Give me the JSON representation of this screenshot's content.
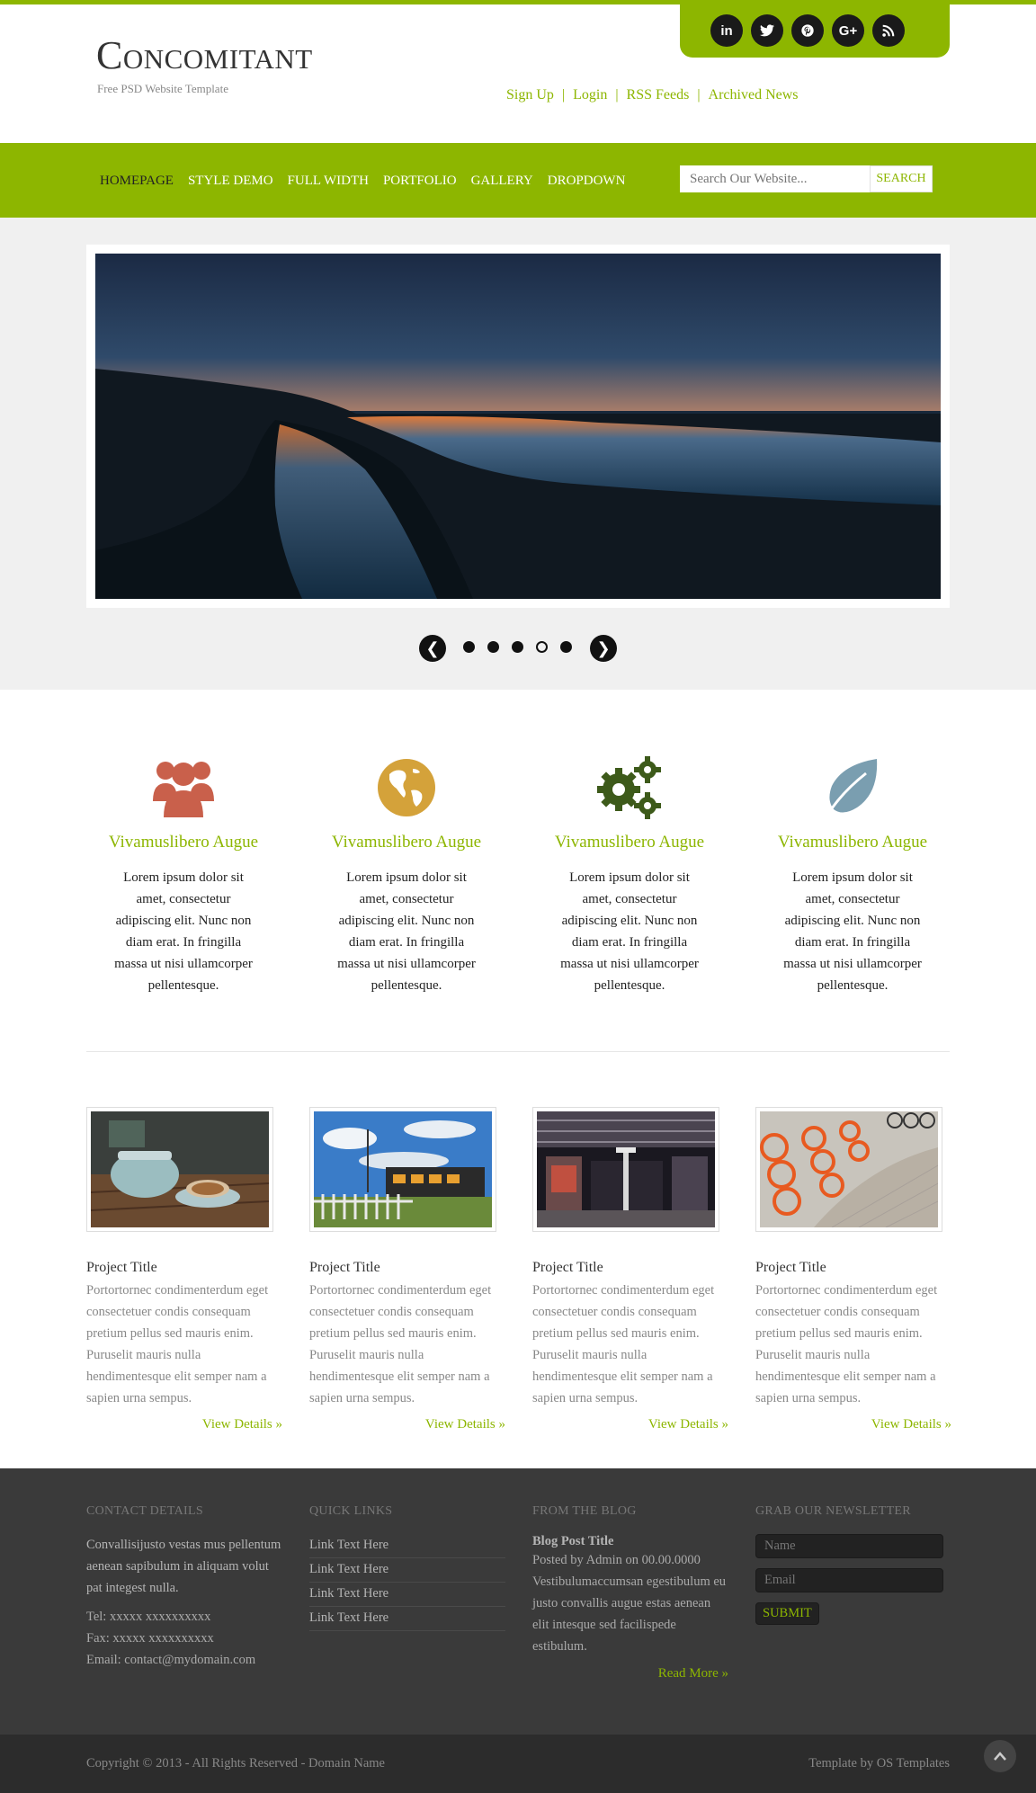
{
  "header": {
    "logo_title": "Concomitant",
    "logo_subtitle": "Free PSD Website Template",
    "social": [
      {
        "icon": "linkedin-icon",
        "glyph": "in"
      },
      {
        "icon": "twitter-icon",
        "glyph": "t"
      },
      {
        "icon": "pinterest-icon",
        "glyph": "p"
      },
      {
        "icon": "google-plus-icon",
        "glyph": "G+"
      },
      {
        "icon": "rss-icon",
        "glyph": "rss"
      }
    ],
    "top_links": [
      "Sign Up",
      "Login",
      "RSS Feeds",
      "Archived News"
    ],
    "separator": "|"
  },
  "nav": {
    "items": [
      "HOMEPAGE",
      "STYLE DEMO",
      "FULL WIDTH",
      "PORTFOLIO",
      "GALLERY",
      "DROPDOWN"
    ],
    "active_index": 0,
    "search_placeholder": "Search Our Website...",
    "search_button": "SEARCH"
  },
  "slider": {
    "prev": "❮",
    "next": "❯",
    "dot_count": 5,
    "active_dot": 3
  },
  "features": [
    {
      "icon": "users-icon",
      "color": "#c9604b",
      "title": "Vivamuslibero Augue",
      "text": "Lorem ipsum dolor sit amet, consectetur adipiscing elit. Nunc non diam erat. In fringilla massa ut nisi ullamcorper pellentesque."
    },
    {
      "icon": "globe-icon",
      "color": "#d4a23a",
      "title": "Vivamuslibero Augue",
      "text": "Lorem ipsum dolor sit amet, consectetur adipiscing elit. Nunc non diam erat. In fringilla massa ut nisi ullamcorper pellentesque."
    },
    {
      "icon": "gears-icon",
      "color": "#3d5a1a",
      "title": "Vivamuslibero Augue",
      "text": "Lorem ipsum dolor sit amet, consectetur adipiscing elit. Nunc non diam erat. In fringilla massa ut nisi ullamcorper pellentesque."
    },
    {
      "icon": "leaf-icon",
      "color": "#7a9eb0",
      "title": "Vivamuslibero Augue",
      "text": "Lorem ipsum dolor sit amet, consectetur adipiscing elit. Nunc non diam erat. In fringilla massa ut nisi ullamcorper pellentesque."
    }
  ],
  "projects": [
    {
      "image": "coffee-cup-photo",
      "title": "Project Title",
      "text": "Portortornec condimenterdum eget consectetuer condis consequam pretium pellus sed mauris enim. Puruselit mauris nulla hendimentesque elit semper nam a sapien urna sempus.",
      "more": "View Details »"
    },
    {
      "image": "train-photo",
      "title": "Project Title",
      "text": "Portortornec condimenterdum eget consectetuer condis consequam pretium pellus sed mauris enim. Puruselit mauris nulla hendimentesque elit semper nam a sapien urna sempus.",
      "more": "View Details »"
    },
    {
      "image": "station-photo",
      "title": "Project Title",
      "text": "Portortornec condimenterdum eget consectetuer condis consequam pretium pellus sed mauris enim. Puruselit mauris nulla hendimentesque elit semper nam a sapien urna sempus.",
      "more": "View Details »"
    },
    {
      "image": "bicycles-photo",
      "title": "Project Title",
      "text": "Portortornec condimenterdum eget consectetuer condis consequam pretium pellus sed mauris enim. Puruselit mauris nulla hendimentesque elit semper nam a sapien urna sempus.",
      "more": "View Details »"
    }
  ],
  "footer": {
    "contact": {
      "heading": "CONTACT DETAILS",
      "text": "Convallisijusto vestas mus pellentum aenean sapibulum in aliquam volut pat integest nulla.",
      "tel": "Tel: xxxxx xxxxxxxxxx",
      "fax": "Fax: xxxxx xxxxxxxxxx",
      "email": "Email: contact@mydomain.com"
    },
    "quick_links": {
      "heading": "QUICK LINKS",
      "links": [
        "Link Text Here",
        "Link Text Here",
        "Link Text Here",
        "Link Text Here"
      ]
    },
    "blog": {
      "heading": "FROM THE BLOG",
      "post_title": "Blog Post Title",
      "meta": "Posted by Admin on 00.00.0000",
      "text": "Vestibulumaccumsan egestibulum eu justo convallis augue estas aenean elit intesque sed facilispede estibulum.",
      "more": "Read More »"
    },
    "newsletter": {
      "heading": "GRAB OUR NEWSLETTER",
      "name_placeholder": "Name",
      "email_placeholder": "Email",
      "submit": "SUBMIT"
    }
  },
  "copyright": {
    "left": "Copyright © 2013 - All Rights Reserved - Domain Name",
    "right": "Template by OS Templates",
    "to_top": "⌃"
  },
  "colors": {
    "accent": "#8db600",
    "footer_bg": "#3a3a3a",
    "copyright_bg": "#2c2c2c"
  }
}
